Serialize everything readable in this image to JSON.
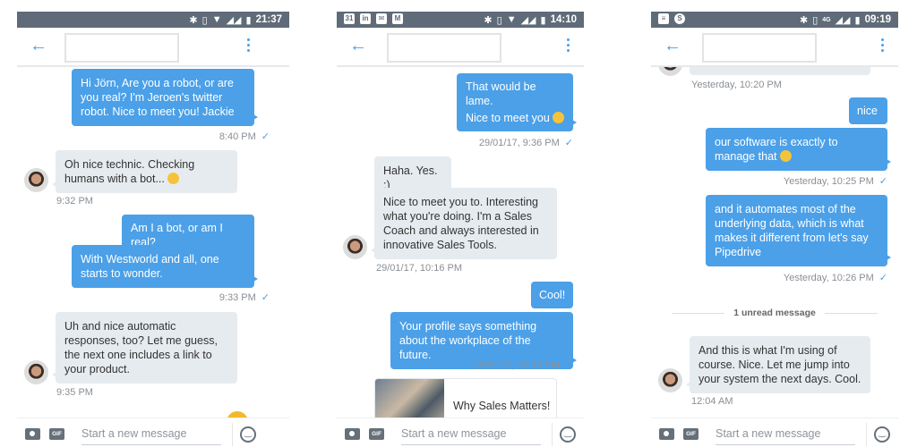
{
  "colors": {
    "accent": "#4ba0e8",
    "incoming_bubble": "#e6ebef",
    "status_bar": "#5f6b78"
  },
  "composer": {
    "placeholder": "Start a new message",
    "gif_label": "GIF"
  },
  "screens": [
    {
      "status_time": "21:37",
      "messages": [
        {
          "dir": "out",
          "text": "Hi Jörn, Are you a robot, or are you real? I'm Jeroen's twitter robot. Nice to meet you! Jackie"
        },
        {
          "time": "8:40 PM",
          "read": "✓"
        },
        {
          "dir": "in",
          "text": "Oh nice technic. Checking humans with a bot...",
          "emoji": "face-with-tongue"
        },
        {
          "time": "9:32 PM"
        },
        {
          "dir": "out",
          "text": "Am I a bot, or am I real?"
        },
        {
          "dir": "out",
          "text": "With Westworld and all, one starts to wonder."
        },
        {
          "time": "9:33 PM",
          "read": "✓"
        },
        {
          "dir": "in",
          "text": "Uh and nice automatic responses, too? Let me guess, the next one includes a link to your product."
        },
        {
          "time": "9:35 PM"
        }
      ]
    },
    {
      "status_time": "14:10",
      "notification_icons": [
        "calendar-icon",
        "linkedin-icon",
        "mail-icon",
        "gmail-icon"
      ],
      "calendar_day": "31",
      "linkedin_label": "in",
      "messages": [
        {
          "dir": "out",
          "text": "That would be lame."
        },
        {
          "dir": "out",
          "text": "Nice to meet you",
          "emoji": "face-with-tongue"
        },
        {
          "time": "29/01/17, 9:36 PM",
          "read": "✓"
        },
        {
          "dir": "in",
          "text": "Haha. Yes. :)"
        },
        {
          "dir": "in",
          "text": "Nice to meet you to. Interesting what you're doing. I'm a Sales Coach and always interested in innovative Sales Tools."
        },
        {
          "time": "29/01/17, 10:16 PM"
        },
        {
          "dir": "out",
          "text": "Cool!"
        },
        {
          "dir": "out",
          "text": "Your profile says something about the workplace of the future."
        },
        {
          "time": "29/01/17, 10:16 PM",
          "read": "✓"
        },
        {
          "card_title": "Why Sales Matters!"
        }
      ]
    },
    {
      "status_time": "09:19",
      "network": "4G",
      "messages": [
        {
          "time": "Yesterday, 10:20 PM"
        },
        {
          "dir": "out",
          "text": "nice"
        },
        {
          "dir": "out",
          "text": "our software is exactly to manage that",
          "emoji": "smiling-face"
        },
        {
          "time": "Yesterday, 10:25 PM",
          "read": "✓"
        },
        {
          "dir": "out",
          "text": "and it automates most of the underlying data, which is what makes it different from let's say Pipedrive"
        },
        {
          "time": "Yesterday, 10:26 PM",
          "read": "✓"
        },
        {
          "divider": "1 unread message"
        },
        {
          "dir": "in",
          "text": "And this is what I'm using of course. Nice. Let me jump into your system the next days. Cool."
        },
        {
          "time": "12:04 AM"
        }
      ]
    }
  ]
}
